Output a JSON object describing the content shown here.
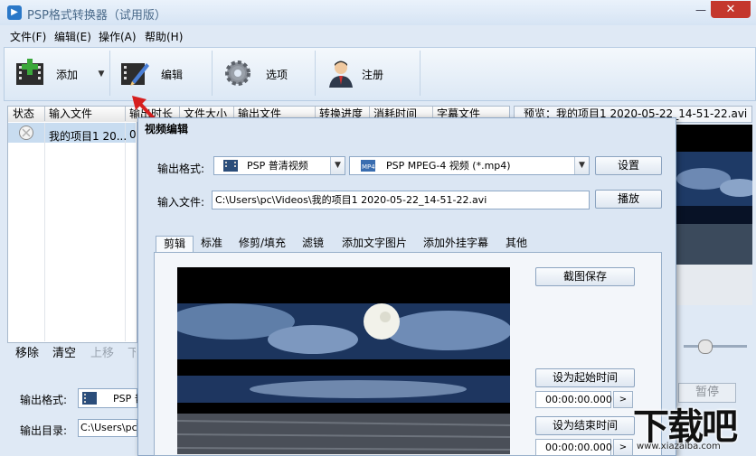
{
  "window": {
    "title": "PSP格式转换器（试用版）",
    "min": "—",
    "max": "□",
    "close": "✕"
  },
  "menu": [
    "文件(F)",
    "编辑(E)",
    "操作(A)",
    "帮助(H)"
  ],
  "toolbar": {
    "add": "添加",
    "edit": "编辑",
    "options": "选项",
    "register": "注册"
  },
  "table": {
    "headers": [
      "状态",
      "输入文件",
      "输出时长",
      "文件大小",
      "输出文件",
      "转换进度",
      "消耗时间",
      "字幕文件"
    ],
    "rows": [
      {
        "input": "我的项目1 20...",
        "duration": "0"
      }
    ]
  },
  "list_buttons": [
    "移除",
    "清空",
    "上移",
    "下"
  ],
  "bottom": {
    "format_label": "输出格式:",
    "format_value": "PSP 普",
    "dir_label": "输出目录:",
    "dir_value": "C:\\Users\\pc\\"
  },
  "preview": {
    "title": "预览：我的项目1 2020-05-22_14-51-22.avi",
    "pause": "暂停"
  },
  "dialog": {
    "title": "视频编辑",
    "format_label": "输出格式:",
    "profile": "PSP 普清视频",
    "codec": "PSP MPEG-4 视频 (*.mp4)",
    "settings_btn": "设置",
    "input_label": "输入文件:",
    "input_path": "C:\\Users\\pc\\Videos\\我的项目1 2020-05-22_14-51-22.avi",
    "play_btn": "播放",
    "tabs": [
      "剪辑",
      "标准",
      "修剪/填充",
      "滤镜",
      "添加文字图片",
      "添加外挂字幕",
      "其他"
    ],
    "active_tab": 0,
    "snapshot_btn": "截图保存",
    "set_start_btn": "设为起始时间",
    "start_time": "00:00:00.000",
    "set_end_btn": "设为结束时间",
    "end_time": "00:00:00.000",
    "arrow": ">"
  },
  "watermark": {
    "text": "下载吧",
    "url": "www.xiazaiba.com"
  }
}
